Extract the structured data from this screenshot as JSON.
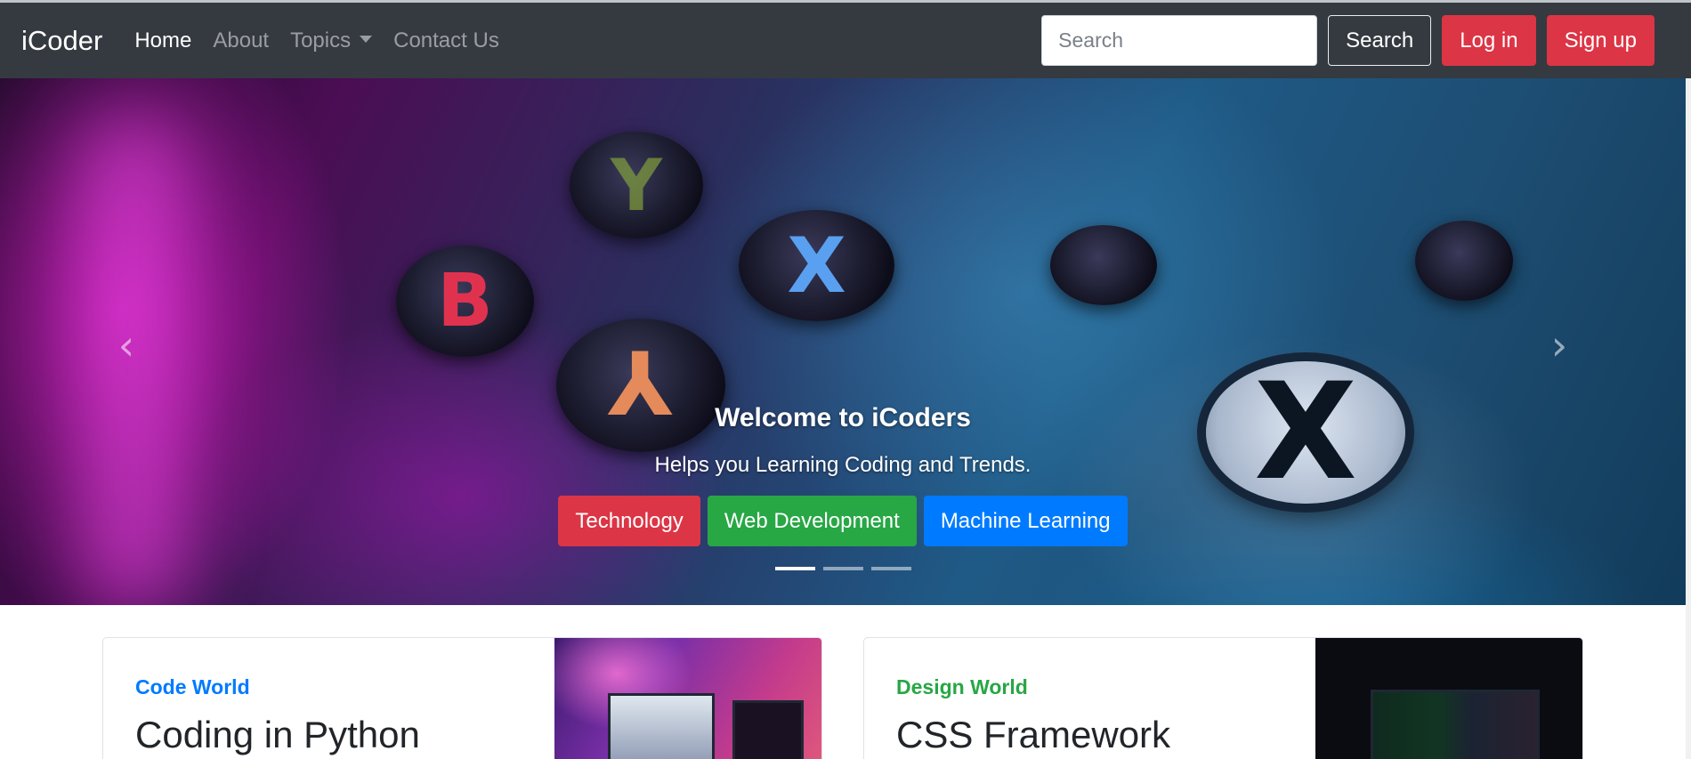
{
  "navbar": {
    "brand": "iCoder",
    "links": [
      {
        "label": "Home",
        "active": true
      },
      {
        "label": "About",
        "active": false
      },
      {
        "label": "Topics",
        "active": false,
        "dropdown": true
      },
      {
        "label": "Contact Us",
        "active": false
      }
    ],
    "search": {
      "placeholder": "Search",
      "value": ""
    },
    "search_button": "Search",
    "login_button": "Log in",
    "signup_button": "Sign up"
  },
  "carousel": {
    "caption_title": "Welcome to iCoders",
    "caption_text": "Helps you Learning Coding and Trends.",
    "buttons": [
      "Technology",
      "Web Development",
      "Machine Learning"
    ],
    "slide_count": 3,
    "active_slide": 0,
    "prev_icon": "chevron-left-icon",
    "next_icon": "chevron-right-icon"
  },
  "cards": [
    {
      "category": "Code World",
      "title": "Coding in Python",
      "category_color": "#007bff"
    },
    {
      "category": "Design World",
      "title": "CSS Framework",
      "category_color": "#28a745"
    }
  ],
  "colors": {
    "navbar": "#343a40",
    "danger": "#dc3545",
    "success": "#28a745",
    "primary": "#007bff"
  }
}
